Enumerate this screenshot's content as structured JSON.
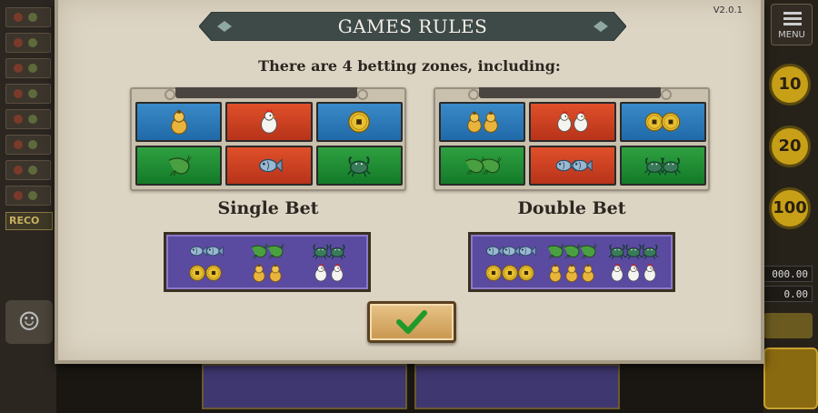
{
  "app": {
    "version": "V2.0.1",
    "title": "GAMES RULES",
    "subtitle": "There are 4 betting zones, including:"
  },
  "background": {
    "menu_label": "MENU",
    "record_label": "RECO",
    "chips": [
      "10",
      "20",
      "100"
    ],
    "amounts": [
      "000.00",
      "0.00"
    ]
  },
  "single_bet": {
    "label": "Single Bet",
    "zones": [
      {
        "icon": "gourd-icon",
        "color": "blue",
        "count": 1
      },
      {
        "icon": "rooster-icon",
        "color": "red",
        "count": 1
      },
      {
        "icon": "coin-icon",
        "color": "blue",
        "count": 1
      },
      {
        "icon": "shrimp-icon",
        "color": "green",
        "count": 1
      },
      {
        "icon": "fish-icon",
        "color": "red",
        "count": 1
      },
      {
        "icon": "crab-icon",
        "color": "green",
        "count": 1
      }
    ],
    "combo": [
      {
        "top": "fish",
        "bottom": "coin"
      },
      {
        "top": "shrimp",
        "bottom": "gourd"
      },
      {
        "top": "crab",
        "bottom": "rooster"
      }
    ]
  },
  "double_bet": {
    "label": "Double Bet",
    "zones": [
      {
        "icon": "gourd-icon",
        "color": "blue",
        "count": 2
      },
      {
        "icon": "rooster-icon",
        "color": "red",
        "count": 2
      },
      {
        "icon": "coin-icon",
        "color": "blue",
        "count": 2
      },
      {
        "icon": "shrimp-icon",
        "color": "green",
        "count": 2
      },
      {
        "icon": "fish-icon",
        "color": "red",
        "count": 2
      },
      {
        "icon": "crab-icon",
        "color": "green",
        "count": 2
      }
    ],
    "combo": [
      {
        "top": "fish",
        "bottom": "coin"
      },
      {
        "top": "shrimp",
        "bottom": "gourd"
      },
      {
        "top": "crab",
        "bottom": "rooster"
      }
    ]
  },
  "colors": {
    "zone_blue": "#2a7ab8",
    "zone_red": "#cc4020",
    "zone_green": "#1f8a34",
    "panel": "#ddd5c4",
    "combo": "#5a4aa0",
    "banner": "#3e4a48"
  }
}
